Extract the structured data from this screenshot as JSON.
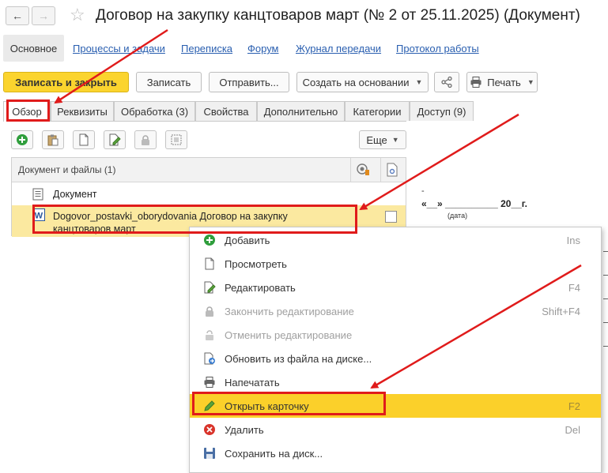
{
  "window": {
    "title": "Договор на закупку канцтоваров март (№ 2 от 25.11.2025) (Документ)",
    "back_icon": "arrow-left",
    "forward_icon": "arrow-right",
    "favorite_icon": "star"
  },
  "top_nav": {
    "active": "Основное",
    "links": [
      "Процессы и задачи",
      "Переписка",
      "Форум",
      "Журнал передачи",
      "Протокол работы"
    ]
  },
  "toolbar": {
    "save_close": "Записать и закрыть",
    "save": "Записать",
    "send": "Отправить...",
    "create_based": "Создать на основании",
    "print": "Печать"
  },
  "tabs": [
    "Обзор",
    "Реквизиты",
    "Обработка (3)",
    "Свойства",
    "Дополнительно",
    "Категории",
    "Доступ (9)"
  ],
  "files_toolbar": {
    "more": "Еще"
  },
  "files_grid": {
    "header": "Документ и файлы (1)",
    "rows": [
      {
        "label": "Документ"
      },
      {
        "label": "Dogovor_postavki_oborydovania Договор на закупку канцтоваров март"
      }
    ]
  },
  "preview": {
    "date_line": "«__» __________ 20__г.",
    "date_caption": "(дата)",
    "dash": "-"
  },
  "context_menu": {
    "items": [
      {
        "label": "Добавить",
        "shortcut": "Ins",
        "icon": "add-icon",
        "disabled": false
      },
      {
        "label": "Просмотреть",
        "shortcut": "",
        "icon": "view-icon",
        "disabled": false
      },
      {
        "label": "Редактировать",
        "shortcut": "F4",
        "icon": "edit-icon",
        "disabled": false
      },
      {
        "label": "Закончить редактирование",
        "shortcut": "Shift+F4",
        "icon": "finish-edit-icon",
        "disabled": true
      },
      {
        "label": "Отменить редактирование",
        "shortcut": "",
        "icon": "cancel-edit-icon",
        "disabled": true
      },
      {
        "label": "Обновить из файла на диске...",
        "shortcut": "",
        "icon": "update-from-file-icon",
        "disabled": false
      },
      {
        "label": "Напечатать",
        "shortcut": "",
        "icon": "printer-icon",
        "disabled": false
      },
      {
        "label": "Открыть карточку",
        "shortcut": "F2",
        "icon": "pencil-icon",
        "disabled": false,
        "highlighted": true
      },
      {
        "label": "Удалить",
        "shortcut": "Del",
        "icon": "delete-icon",
        "disabled": false
      },
      {
        "label": "Сохранить на диск...",
        "shortcut": "",
        "icon": "save-disk-icon",
        "disabled": false
      }
    ]
  },
  "colors": {
    "primary_button": "#fbd42e",
    "selection": "#fbe9a0",
    "menu_highlight": "#fbd02a",
    "annotation": "#e01b1b",
    "link": "#2a5fb0"
  }
}
